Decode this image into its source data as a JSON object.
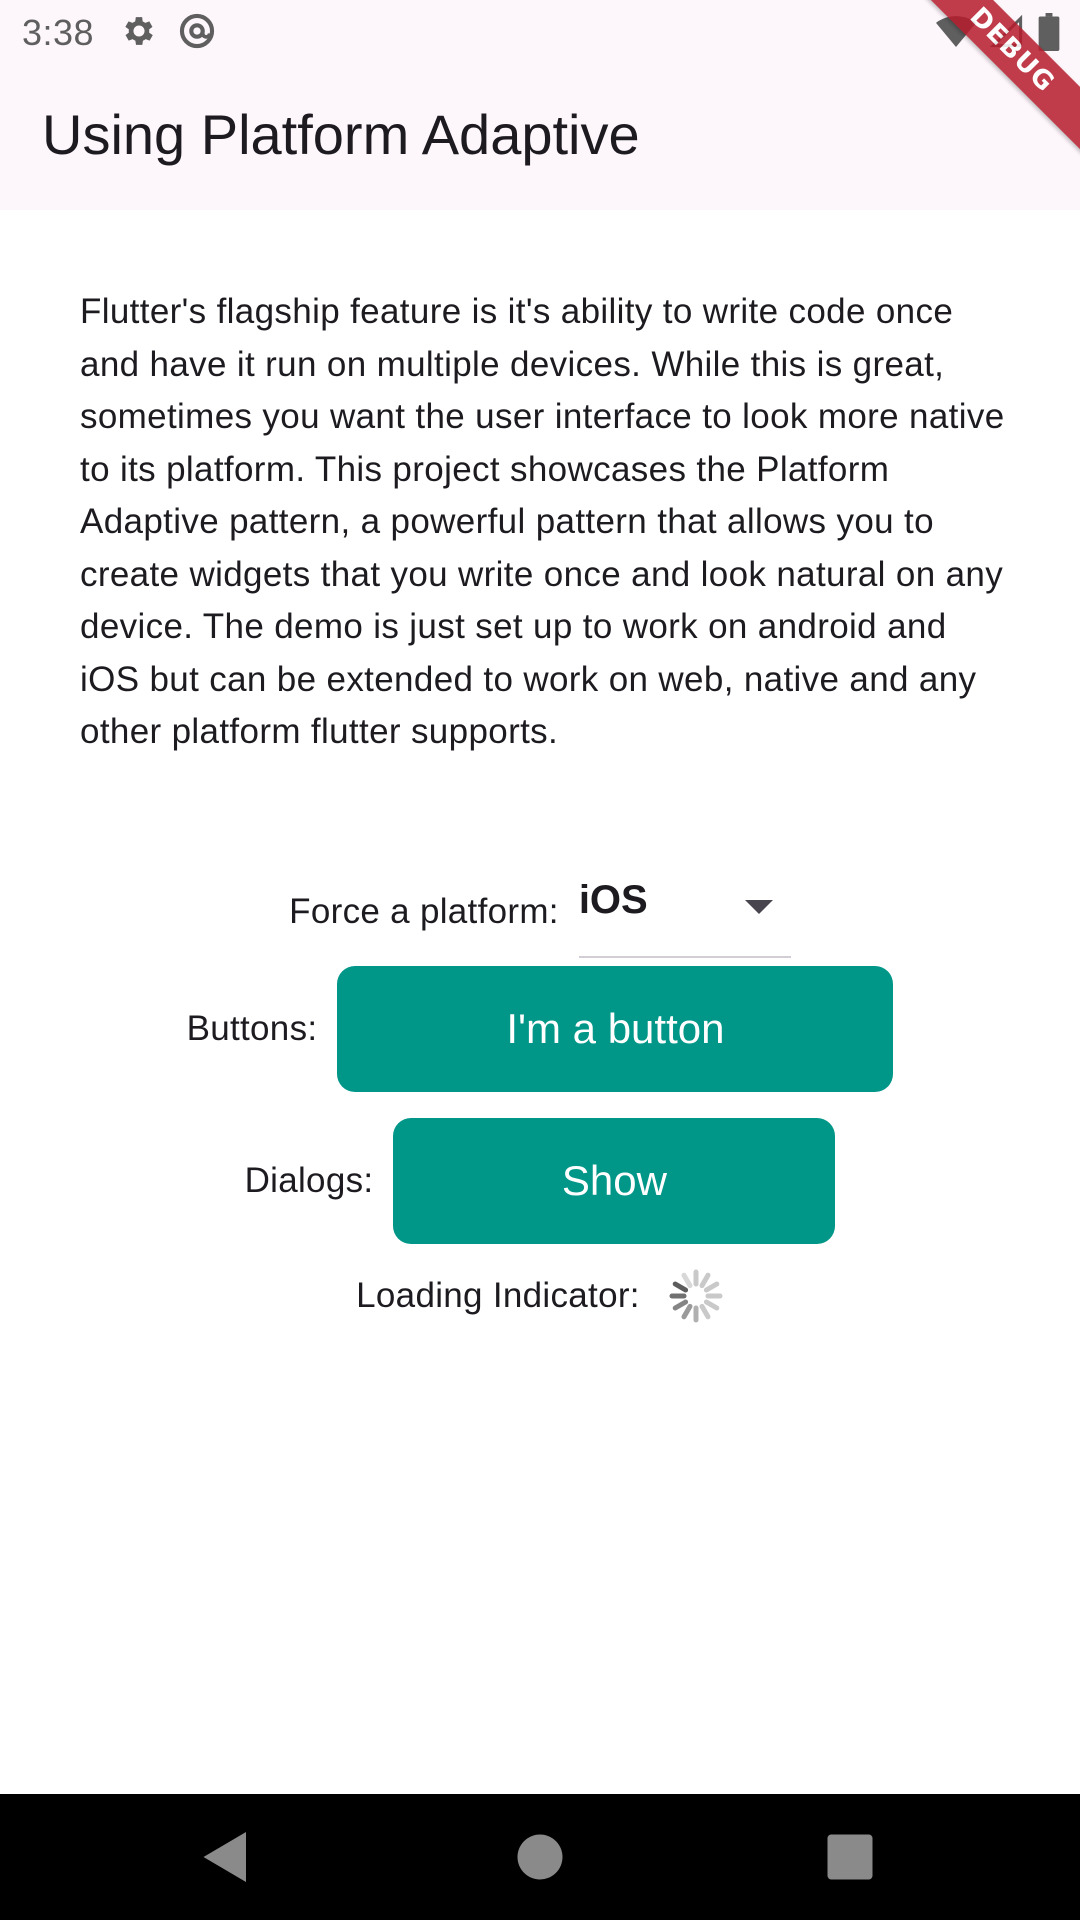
{
  "status_bar": {
    "time": "3:38",
    "left_icons": [
      "gear-icon",
      "at-sign-icon"
    ],
    "right_icons": [
      "wifi-icon",
      "cellular-signal-icon",
      "battery-icon"
    ]
  },
  "debug_banner": {
    "label": "DEBUG",
    "color": "#b71c2c"
  },
  "app_bar": {
    "title": "Using Platform Adaptive"
  },
  "description": "Flutter's flagship feature is it's ability to write code once and have it run on multiple devices. While this is great, sometimes you want the user interface to look more native to its platform. This project showcases the Platform Adaptive pattern, a powerful pattern that allows you to create widgets that you write once and look natural on any device. The demo is just set up to work on android and iOS but can be extended to work on web, native and any other platform flutter supports.",
  "platform_row": {
    "label": "Force a platform:",
    "selected": "iOS"
  },
  "buttons_row": {
    "label": "Buttons:",
    "button_label": "I'm a button"
  },
  "dialogs_row": {
    "label": "Dialogs:",
    "button_label": "Show"
  },
  "loading_row": {
    "label": "Loading Indicator:",
    "indicator": "activity-spinner-icon"
  },
  "nav_bar": {
    "buttons": [
      "back-icon",
      "home-icon",
      "recents-icon"
    ]
  },
  "colors": {
    "accent": "#009688",
    "app_bar_background": "#fdf7fc",
    "nav_bar_background": "#000000"
  }
}
